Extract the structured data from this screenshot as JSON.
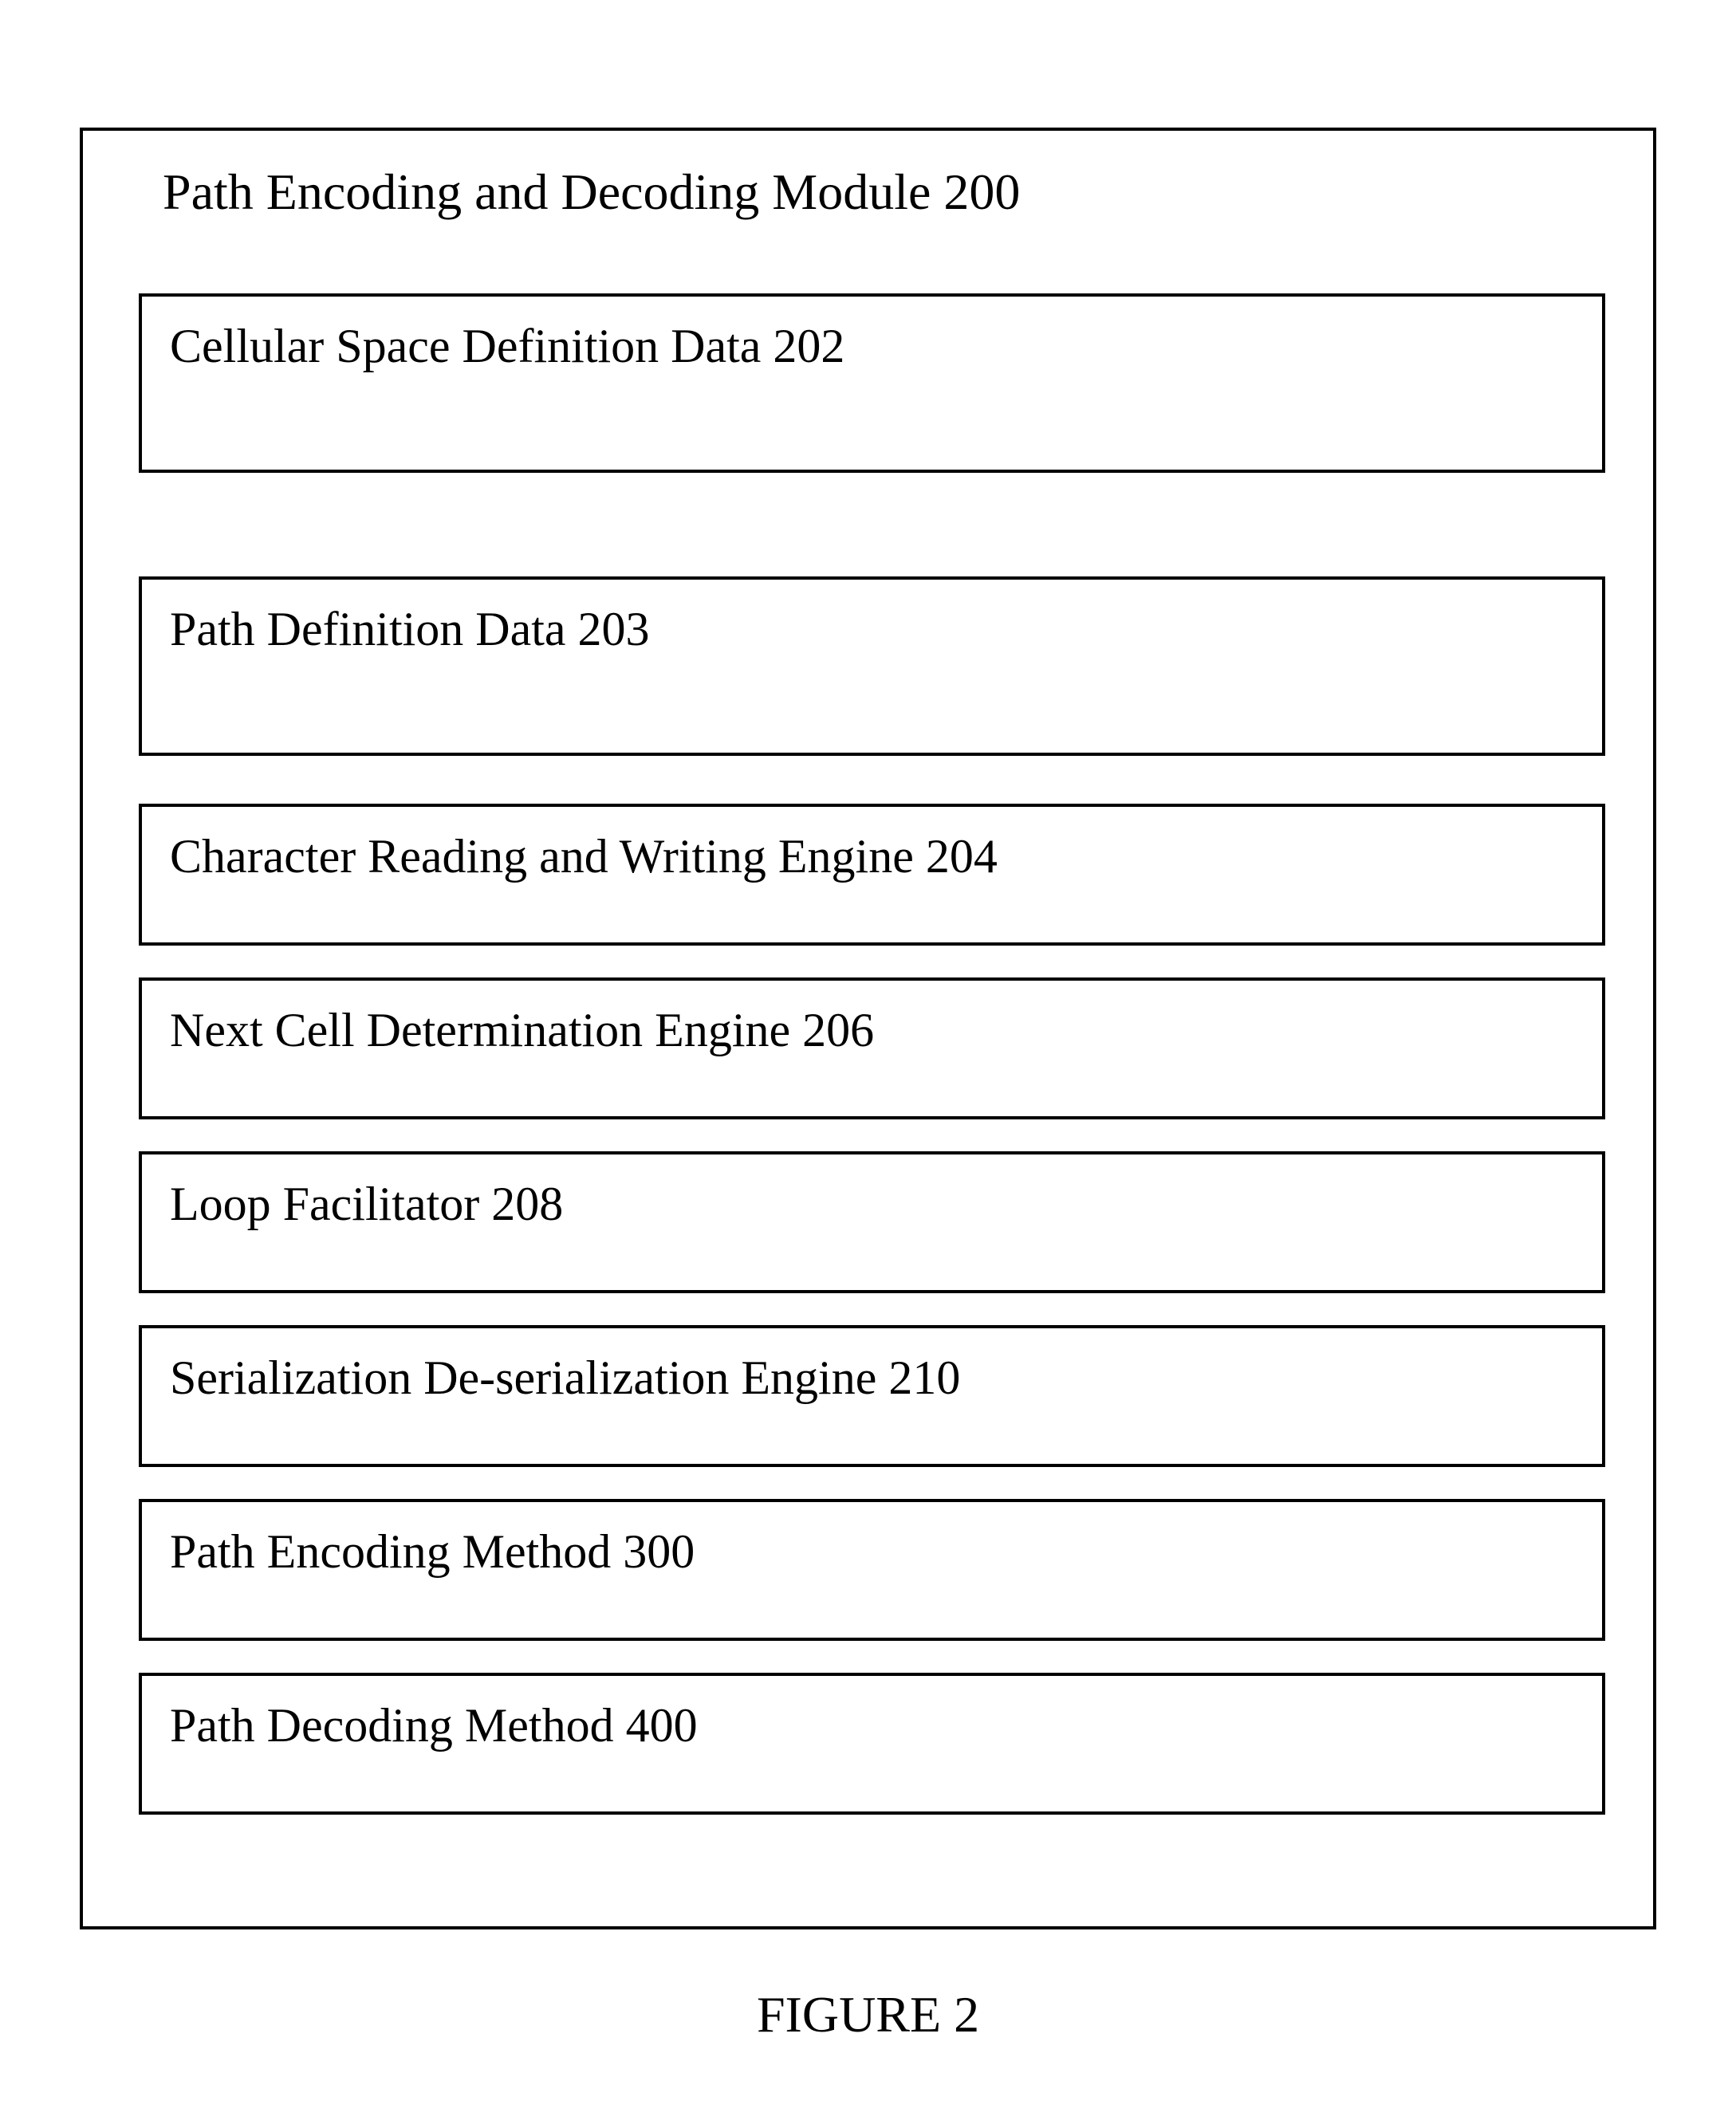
{
  "module": {
    "title": "Path Encoding and Decoding Module 200",
    "boxes": {
      "b202": "Cellular Space Definition Data 202",
      "b203": "Path Definition Data 203",
      "b204": "Character Reading and Writing Engine 204",
      "b206": "Next Cell Determination Engine 206",
      "b208": "Loop Facilitator 208",
      "b210": "Serialization De-serialization Engine 210",
      "b300": "Path Encoding Method 300",
      "b400": "Path Decoding Method 400"
    }
  },
  "caption": "FIGURE 2"
}
